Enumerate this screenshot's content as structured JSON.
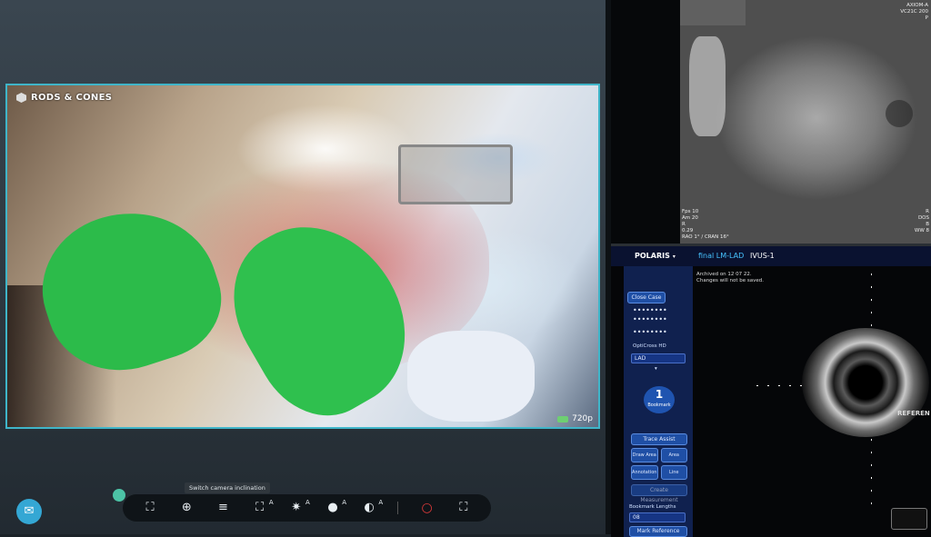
{
  "video": {
    "brand": "RODS & CONES",
    "resolution": "720p"
  },
  "toolbar": {
    "tooltip": "Switch camera inclination",
    "tools": [
      {
        "name": "frame-icon",
        "glyph": "⛶",
        "sup": ""
      },
      {
        "name": "zoom-icon",
        "glyph": "⊕",
        "sup": ""
      },
      {
        "name": "camera-inclination-icon",
        "glyph": "≡",
        "sup": ""
      },
      {
        "name": "autofocus-icon",
        "glyph": "⛶",
        "sup": "A"
      },
      {
        "name": "brightness-icon",
        "glyph": "✷",
        "sup": "A"
      },
      {
        "name": "exposure-icon",
        "glyph": "●",
        "sup": "A"
      },
      {
        "name": "contrast-icon",
        "glyph": "◐",
        "sup": "A"
      },
      {
        "name": "record-icon",
        "glyph": "○",
        "sup": ""
      },
      {
        "name": "fullscreen-icon",
        "glyph": "⛶",
        "sup": ""
      }
    ]
  },
  "xray": {
    "top_right_lines": [
      "AXIOM-A",
      "VC21C 200",
      "P"
    ],
    "bottom_left_lines": [
      "Fps 10",
      "Am 20",
      "R",
      "0.29",
      "RAO 1° / CRAN 16°"
    ],
    "bottom_right_lines": [
      "R",
      "DOS",
      "B",
      "WW 8"
    ]
  },
  "ivus": {
    "app_name": "POLARIS",
    "case_title": "final LM-LAD",
    "tab": "IVUS-1",
    "archive_note_1": "Archived on 12 07 22.",
    "archive_note_2": "Changes will not be saved.",
    "close_case": "Close Case",
    "password_dots_1": "••••••••",
    "password_dots_2": "••••••••",
    "password_dots_3": "••••••••",
    "device": "OptiCross HD",
    "vessel": "LAD",
    "bookmark_number": "1",
    "bookmark_label": "Bookmark",
    "trace_assist": "Trace Assist",
    "tools": [
      {
        "label": "Draw Area"
      },
      {
        "label": "Area"
      },
      {
        "label": "Annotation"
      },
      {
        "label": "Line"
      }
    ],
    "create_measurement": "Create Measurement",
    "bookmark_lengths": "Bookmark Lengths",
    "bookmark_value": "08",
    "mark_reference": "Mark Reference",
    "reference_label": "REFEREN"
  }
}
